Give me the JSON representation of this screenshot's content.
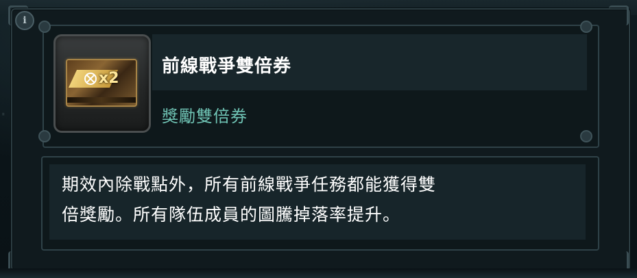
{
  "item": {
    "title": "前線戰爭雙倍券",
    "subtitle": "獎勵雙倍券",
    "icon": "double-reward-ticket-icon",
    "ticket_label": "x2"
  },
  "description": {
    "line1": "期效內除戰點外，所有前線戰爭任務都能獲得雙",
    "line2": "倍獎勵。所有隊伍成員的圖騰掉落率提升。"
  },
  "info_button": {
    "label": "i"
  },
  "colors": {
    "title": "#ffffff",
    "subtitle": "#6fc3b4",
    "panel": "#0e181b",
    "border": "#2f4248",
    "ticket_gold": "#c89a3a"
  }
}
